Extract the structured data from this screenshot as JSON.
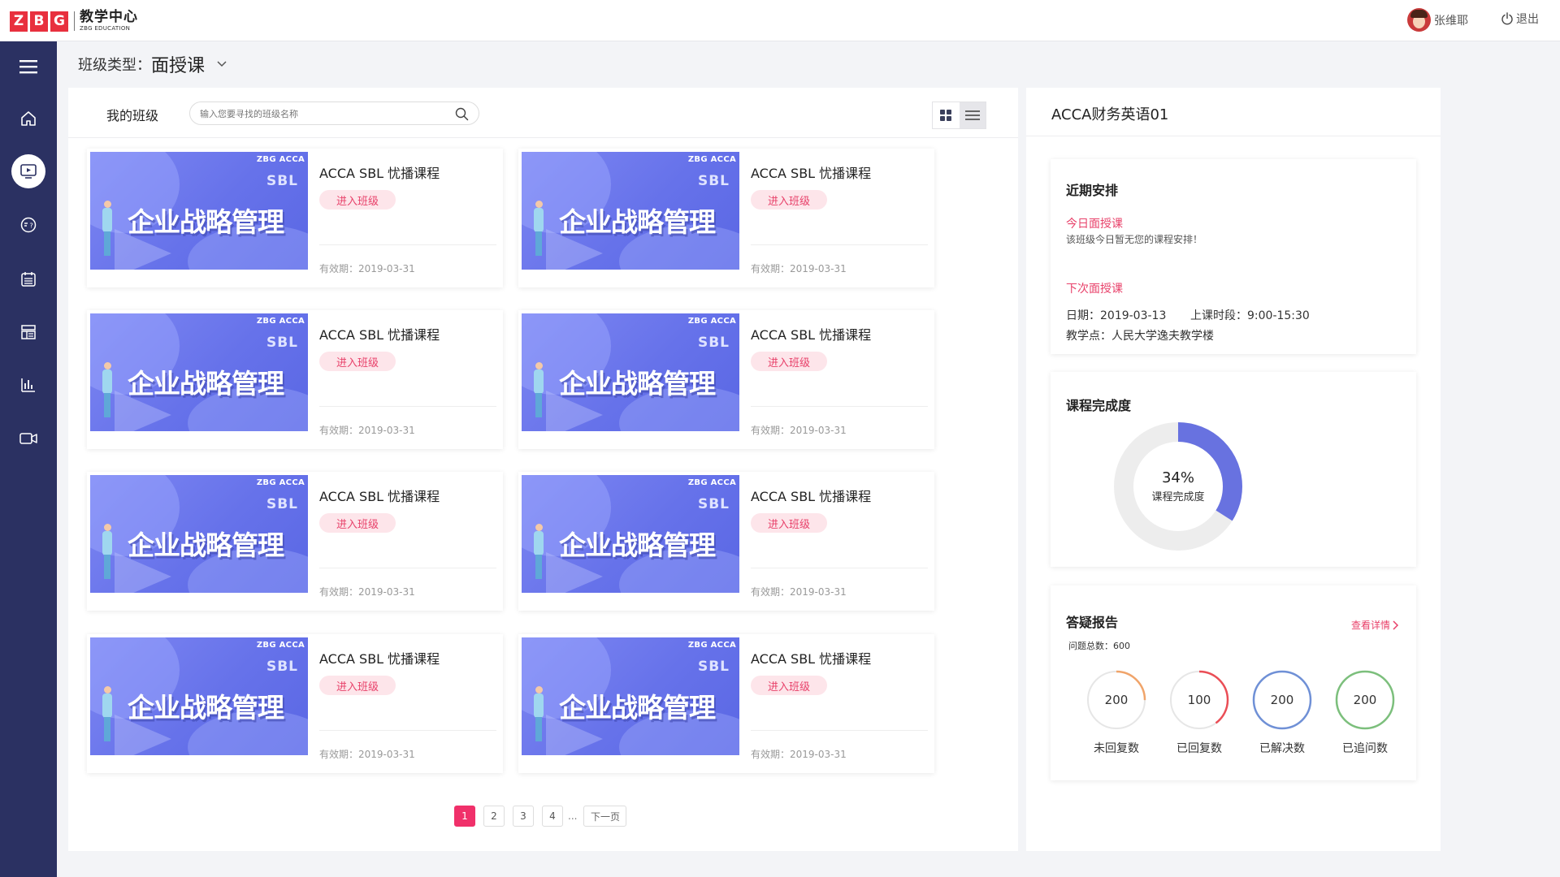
{
  "header": {
    "logo_letters": [
      "Z",
      "B",
      "G"
    ],
    "logo_title": "教学中心",
    "logo_subtitle": "ZBG EDUCATION",
    "user_name": "张维耶",
    "logout_label": "退出"
  },
  "sidebar": {
    "items": [
      {
        "icon": "menu-icon"
      },
      {
        "icon": "home-icon"
      },
      {
        "icon": "video-class-icon",
        "active": true
      },
      {
        "icon": "qa-chat-icon"
      },
      {
        "icon": "calendar-icon"
      },
      {
        "icon": "layout-icon"
      },
      {
        "icon": "bar-chart-icon"
      },
      {
        "icon": "camera-icon"
      }
    ]
  },
  "class_type": {
    "label": "班级类型：",
    "value": "面授课"
  },
  "my_classes": {
    "title": "我的班级",
    "search_placeholder": "输入您要寻找的班级名称",
    "cards": [
      {
        "brand": "ZBG ACCA",
        "thumb_sbl": "SBL",
        "thumb_title": "企业战略管理",
        "title": "ACCA SBL 忧播课程",
        "button": "进入班级",
        "valid": "有效期：2019-03-31"
      },
      {
        "brand": "ZBG ACCA",
        "thumb_sbl": "SBL",
        "thumb_title": "企业战略管理",
        "title": "ACCA SBL 忧播课程",
        "button": "进入班级",
        "valid": "有效期：2019-03-31"
      },
      {
        "brand": "ZBG ACCA",
        "thumb_sbl": "SBL",
        "thumb_title": "企业战略管理",
        "title": "ACCA SBL 忧播课程",
        "button": "进入班级",
        "valid": "有效期：2019-03-31"
      },
      {
        "brand": "ZBG ACCA",
        "thumb_sbl": "SBL",
        "thumb_title": "企业战略管理",
        "title": "ACCA SBL 忧播课程",
        "button": "进入班级",
        "valid": "有效期：2019-03-31"
      },
      {
        "brand": "ZBG ACCA",
        "thumb_sbl": "SBL",
        "thumb_title": "企业战略管理",
        "title": "ACCA SBL 忧播课程",
        "button": "进入班级",
        "valid": "有效期：2019-03-31"
      },
      {
        "brand": "ZBG ACCA",
        "thumb_sbl": "SBL",
        "thumb_title": "企业战略管理",
        "title": "ACCA SBL 忧播课程",
        "button": "进入班级",
        "valid": "有效期：2019-03-31"
      },
      {
        "brand": "ZBG ACCA",
        "thumb_sbl": "SBL",
        "thumb_title": "企业战略管理",
        "title": "ACCA SBL 忧播课程",
        "button": "进入班级",
        "valid": "有效期：2019-03-31"
      },
      {
        "brand": "ZBG ACCA",
        "thumb_sbl": "SBL",
        "thumb_title": "企业战略管理",
        "title": "ACCA SBL 忧播课程",
        "button": "进入班级",
        "valid": "有效期：2019-03-31"
      }
    ],
    "pagination": {
      "pages": [
        "1",
        "2",
        "3",
        "4"
      ],
      "current": "1",
      "ellipsis": "...",
      "next": "下一页"
    }
  },
  "detail": {
    "title": "ACCA财务英语01",
    "schedule": {
      "heading": "近期安排",
      "today_label": "今日面授课",
      "today_text": "该班级今日暂无您的课程安排！",
      "next_label": "下次面授课",
      "date": "日期：2019-03-13",
      "time": "上课时段：9:00-15:30",
      "location": "教学点：人民大学逸夫教学楼"
    },
    "completion": {
      "heading": "课程完成度",
      "percent": 34,
      "percent_text": "34%",
      "label": "课程完成度",
      "color": "#6872e0",
      "track_color": "#ededed"
    },
    "qa_report": {
      "heading": "答疑报告",
      "details_link": "查看详情",
      "total": "问题总数：600",
      "stats": [
        {
          "value": "200",
          "label": "未回复数",
          "color": "#f0a46a",
          "fraction": 0.25
        },
        {
          "value": "100",
          "label": "已回复数",
          "color": "#ea4e56",
          "fraction": 0.4
        },
        {
          "value": "200",
          "label": "已解决数",
          "color": "#6f90d6",
          "fraction": 1
        },
        {
          "value": "200",
          "label": "已追问数",
          "color": "#7cbf7c",
          "fraction": 1
        }
      ]
    }
  }
}
